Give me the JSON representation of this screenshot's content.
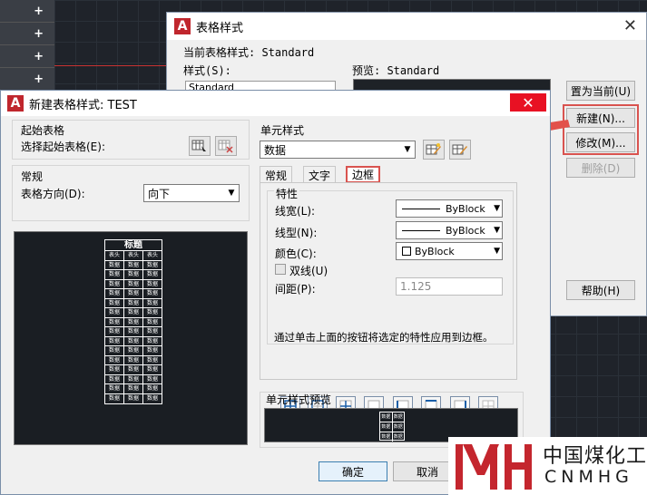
{
  "background": {
    "palette_items": [
      "+",
      "+",
      "+",
      "+"
    ]
  },
  "back_dialog": {
    "title": "表格样式",
    "close": "✕",
    "current_style_label": "当前表格样式: Standard",
    "styles_label": "样式(S):",
    "styles_list_value": "Standard",
    "preview_label": "预览: Standard",
    "buttons": {
      "set_current": "置为当前(U)",
      "new": "新建(N)...",
      "modify": "修改(M)...",
      "delete": "删除(D)",
      "help": "帮助(H)"
    }
  },
  "front_dialog": {
    "title": "新建表格样式: TEST",
    "close": "✕",
    "start_table": {
      "group_title": "起始表格",
      "select_label": "选择起始表格(E):"
    },
    "general": {
      "group_title": "常规",
      "direction_label": "表格方向(D):",
      "direction_value": "向下"
    },
    "preview_table": {
      "title": "标题",
      "header_cells": [
        "表头",
        "表头",
        "表头"
      ],
      "data_cell": "数据",
      "data_rows": 15
    },
    "cell_styles": {
      "group_title": "单元样式",
      "selected": "数据"
    },
    "tabs": [
      "常规",
      "文字",
      "边框"
    ],
    "active_tab": "边框",
    "properties": {
      "group_title": "特性",
      "lineweight_label": "线宽(L):",
      "lineweight_value": "ByBlock",
      "linetype_label": "线型(N):",
      "linetype_value": "ByBlock",
      "color_label": "颜色(C):",
      "color_value": "ByBlock",
      "double_line_label": "双线(U)",
      "spacing_label": "间距(P):",
      "spacing_value": "1.125",
      "hint": "通过单击上面的按钮将选定的特性应用到边框。"
    },
    "cell_preview": {
      "group_title": "单元样式预览",
      "cell_text": "数据"
    },
    "buttons": {
      "ok": "确定",
      "cancel": "取消"
    }
  },
  "watermark": {
    "cn": "中国煤化工",
    "en": "CNMHG"
  },
  "colors": {
    "highlight": "#d9534f",
    "autocad_red": "#c0262d",
    "close_red": "#e81123"
  }
}
